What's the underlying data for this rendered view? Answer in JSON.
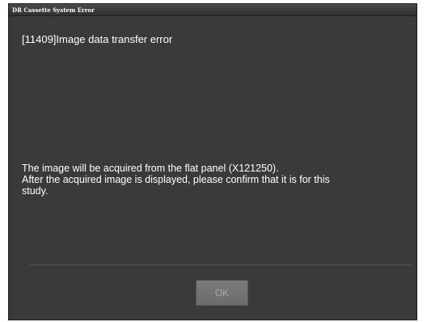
{
  "window": {
    "title": "DR Cassette System Error"
  },
  "error": {
    "heading": "[11409]Image data transfer error",
    "message_lines": [
      "The image will be acquired from the flat panel (X121250).",
      "After the acquired image is displayed, please confirm that it is for this",
      "study."
    ]
  },
  "buttons": {
    "ok_label": "OK",
    "ok_enabled": false
  },
  "colors": {
    "background": "#3a3a3a",
    "text": "#ffffff",
    "button_disabled_text": "#a9a9a9"
  }
}
